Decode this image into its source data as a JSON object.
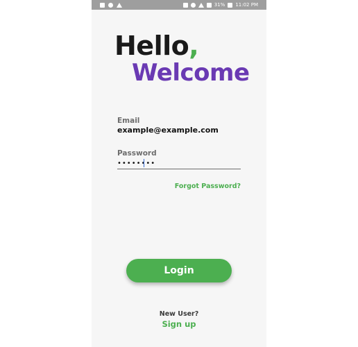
{
  "status_bar": {
    "icons_left": [
      "image-icon",
      "shield-icon",
      "usb-icon"
    ],
    "icons_right": [
      "mute-icon",
      "alarm-icon",
      "wifi-icon",
      "signal-icon",
      "battery-icon"
    ],
    "battery_percent": "31%",
    "time": "11:02 PM"
  },
  "header": {
    "hello": "Hello",
    "comma": ",",
    "welcome": "Welcome"
  },
  "form": {
    "email_label": "Email",
    "email_value": "example@example.com",
    "password_label": "Password",
    "password_value": "••••••••",
    "forgot_password": "Forgot Password?"
  },
  "actions": {
    "login_label": "Login",
    "new_user_text": "New User?",
    "signup_label": "Sign up"
  },
  "colors": {
    "accent_green": "#4caf50",
    "accent_purple": "#6a3ab3",
    "title_dark": "#1a1a1a",
    "background": "#f6f6f6"
  }
}
